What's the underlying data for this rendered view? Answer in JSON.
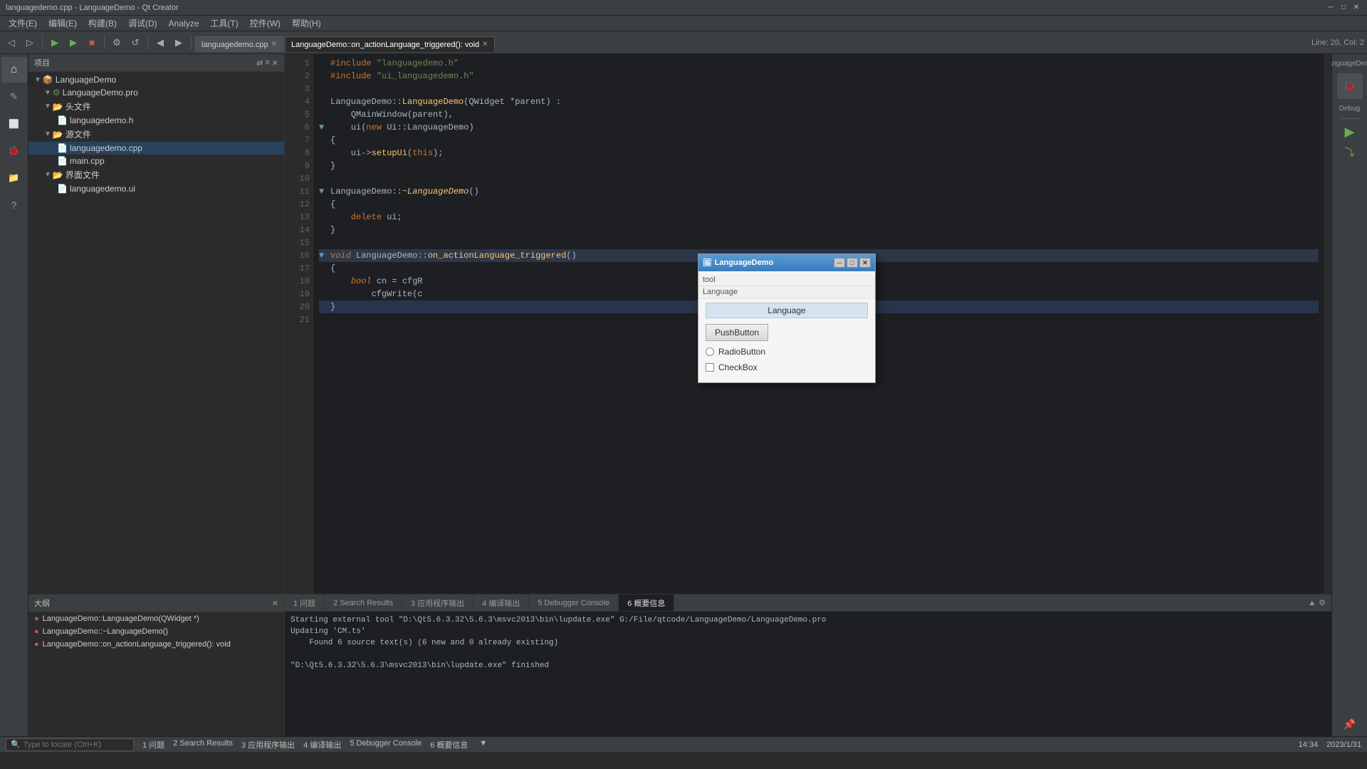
{
  "window": {
    "title": "languagedemo.cpp - LanguageDemo - Qt Creator",
    "minimize": "─",
    "maximize": "□",
    "close": "✕"
  },
  "menubar": {
    "items": [
      "文件(E)",
      "编辑(E)",
      "构建(B)",
      "调试(D)",
      "Analyze",
      "工具(T)",
      "控件(W)",
      "帮助(H)"
    ]
  },
  "toolbar": {
    "breadcrumb": "Line: 20, Col: 2"
  },
  "tabs": [
    {
      "label": "languagedemo.cpp",
      "active": false
    },
    {
      "label": "LanguageDemo::on_actionLanguage_triggered(): void",
      "active": true
    }
  ],
  "project": {
    "header": "项目",
    "tree": [
      {
        "level": 0,
        "icon": "▼",
        "type": "folder",
        "label": "LanguageDemo",
        "color": "blue"
      },
      {
        "level": 1,
        "icon": "▼",
        "type": "file",
        "label": "LanguageDemo.pro",
        "color": "green"
      },
      {
        "level": 1,
        "icon": "▼",
        "type": "folder",
        "label": "头文件",
        "color": "normal"
      },
      {
        "level": 2,
        "icon": "",
        "type": "file",
        "label": "languagedemo.h",
        "color": "blue"
      },
      {
        "level": 1,
        "icon": "▼",
        "type": "folder",
        "label": "源文件",
        "color": "normal"
      },
      {
        "level": 2,
        "icon": "",
        "type": "file",
        "label": "languagedemo.cpp",
        "color": "blue",
        "selected": true
      },
      {
        "level": 2,
        "icon": "",
        "type": "file",
        "label": "main.cpp",
        "color": "blue"
      },
      {
        "level": 1,
        "icon": "▼",
        "type": "folder",
        "label": "界面文件",
        "color": "normal"
      },
      {
        "level": 2,
        "icon": "",
        "type": "file",
        "label": "languagedemo.ui",
        "color": "orange"
      }
    ]
  },
  "outline": {
    "header": "大纲",
    "items": [
      {
        "label": "LanguageDemo::LanguageDemo(QWidget *)",
        "color": "red"
      },
      {
        "label": "LanguageDemo::~LanguageDemo()",
        "color": "red"
      },
      {
        "label": "LanguageDemo::on_actionLanguage_triggered(): void",
        "color": "red"
      }
    ]
  },
  "code": {
    "lines": [
      {
        "num": 1,
        "arrow": "",
        "content": "#include \"languagedemo.h\"",
        "type": "include"
      },
      {
        "num": 2,
        "arrow": "",
        "content": "#include \"ui_languagedemo.h\"",
        "type": "include"
      },
      {
        "num": 3,
        "arrow": "",
        "content": "",
        "type": "blank"
      },
      {
        "num": 4,
        "arrow": "",
        "content": "LanguageDemo::LanguageDemo(QWidget *parent) :",
        "type": "code"
      },
      {
        "num": 5,
        "arrow": "",
        "content": "    QMainWindow(parent),",
        "type": "code"
      },
      {
        "num": 6,
        "arrow": "▼",
        "content": "    ui(new Ui::LanguageDemo)",
        "type": "code"
      },
      {
        "num": 7,
        "arrow": "",
        "content": "{",
        "type": "code"
      },
      {
        "num": 8,
        "arrow": "",
        "content": "    ui->setupUi(this);",
        "type": "code"
      },
      {
        "num": 9,
        "arrow": "",
        "content": "}",
        "type": "code"
      },
      {
        "num": 10,
        "arrow": "",
        "content": "",
        "type": "blank"
      },
      {
        "num": 11,
        "arrow": "▼",
        "content": "LanguageDemo::~LanguageDemo()",
        "type": "code"
      },
      {
        "num": 12,
        "arrow": "",
        "content": "{",
        "type": "code"
      },
      {
        "num": 13,
        "arrow": "",
        "content": "    delete ui;",
        "type": "code"
      },
      {
        "num": 14,
        "arrow": "",
        "content": "}",
        "type": "code"
      },
      {
        "num": 15,
        "arrow": "",
        "content": "",
        "type": "blank"
      },
      {
        "num": 16,
        "arrow": "▼",
        "content": "void LanguageDemo::on_actionLanguage_triggered()",
        "type": "code",
        "highlighted": true
      },
      {
        "num": 17,
        "arrow": "",
        "content": "{",
        "type": "code"
      },
      {
        "num": 18,
        "arrow": "",
        "content": "    bool cn = cfgR",
        "type": "code"
      },
      {
        "num": 19,
        "arrow": "",
        "content": "        cfgWrite(c",
        "type": "code"
      },
      {
        "num": 20,
        "arrow": "",
        "content": "}",
        "type": "code",
        "current": true
      },
      {
        "num": 21,
        "arrow": "",
        "content": "",
        "type": "blank"
      }
    ]
  },
  "output": {
    "tabs": [
      "1 问题",
      "2 Search Results",
      "3 应用程序输出",
      "4 编译输出",
      "5 Debugger Console",
      "6 概要信息"
    ],
    "active_tab": 5,
    "content": [
      "Starting external tool \"D:\\Qt5.6.3.32\\5.6.3\\msvc2013\\bin\\lupdate.exe\" G:/File/qtcode/LanguageDemo/LanguageDemo.pro",
      "Updating 'CM.ts'",
      "    Found 6 source text(s) (6 new and 0 already existing)",
      "",
      "\"D:\\Qt5.6.3.32\\5.6.3\\msvc2013\\bin\\lupdate.exe\" finished"
    ]
  },
  "dialog": {
    "title": "LanguageDemo",
    "menu_label": "tool",
    "toolbar_label": "Language",
    "push_button": "PushButton",
    "radio_button": "RadioButton",
    "checkbox": "CheckBox"
  },
  "statusbar": {
    "search_placeholder": "Type to locate (Ctrl+K)",
    "items": [
      "1 问题",
      "2 Search Results",
      "3 应用程序输出",
      "4 编译输出",
      "5 Debugger Console",
      "6 概要信息"
    ],
    "right": "Line: 20, Col: 2",
    "time": "14:34",
    "date": "2023/1/31"
  },
  "debug_panel": {
    "label": "LanguageDemo",
    "button": "Debug"
  }
}
